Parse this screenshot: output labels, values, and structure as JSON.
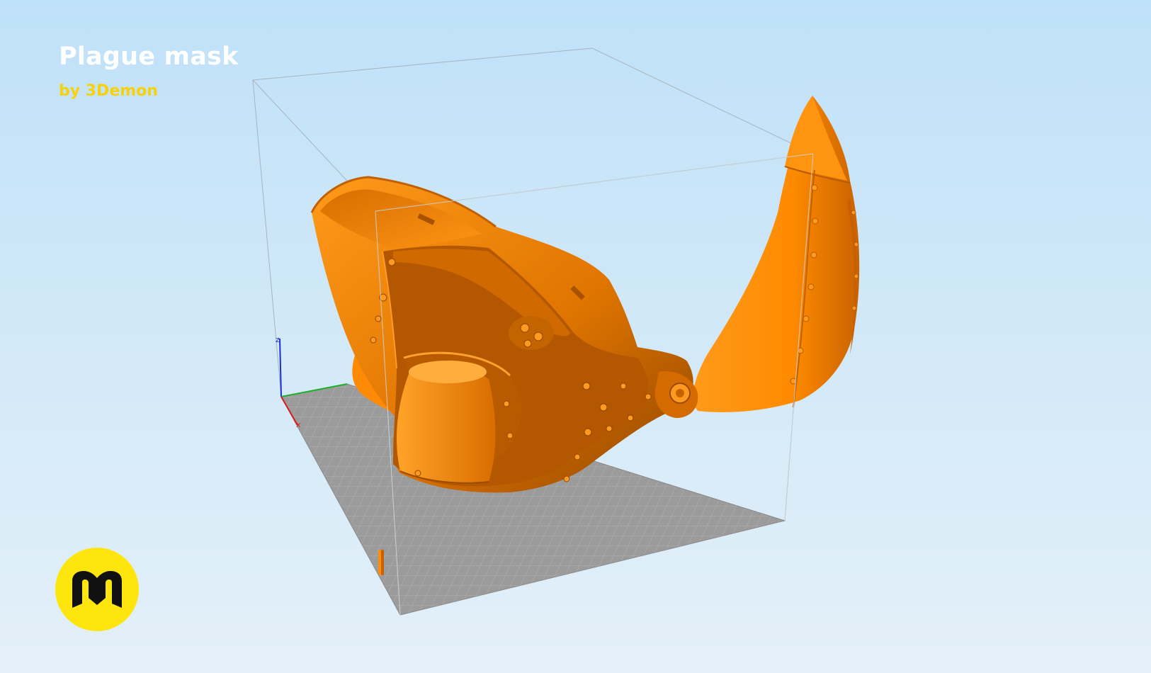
{
  "overlay": {
    "title": "Plague mask",
    "subtitle": "by 3Demon"
  },
  "axes": {
    "z_label": "z",
    "x_label": "x"
  },
  "logo": {
    "icon": "3demon-logo-icon",
    "badge_color": "#fde50d",
    "glyph_color": "#111111"
  },
  "colors": {
    "model": "#ff8c0a",
    "model_shadow": "#a85200",
    "bed": "#9a9a9a",
    "bed_grid": "#b8b8b8",
    "title": "#ffffff",
    "subtitle": "#f5d20a"
  }
}
